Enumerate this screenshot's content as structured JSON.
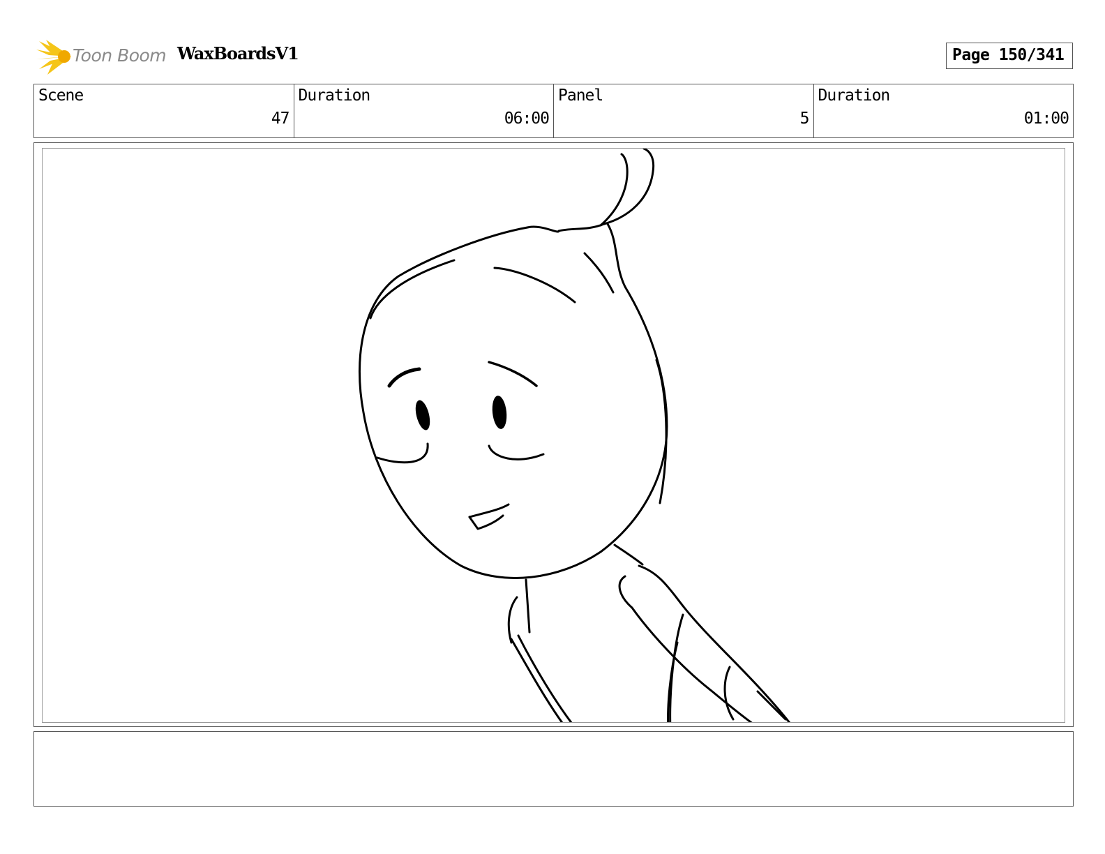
{
  "header": {
    "logo_text": "Toon Boom",
    "project_title": "WaxBoardsV1",
    "page_label": "Page 150/341"
  },
  "info": [
    {
      "label": "Scene",
      "value": "47"
    },
    {
      "label": "Duration",
      "value": "06:00"
    },
    {
      "label": "Panel",
      "value": "5"
    },
    {
      "label": "Duration",
      "value": "01:00"
    }
  ],
  "notes": {
    "text": ""
  },
  "colors": {
    "logo_accent": "#f5c518",
    "logo_text": "#8a8a8a",
    "frame_border": "#555555"
  },
  "icons": {
    "logo": "toon-boom-sunburst-icon"
  }
}
